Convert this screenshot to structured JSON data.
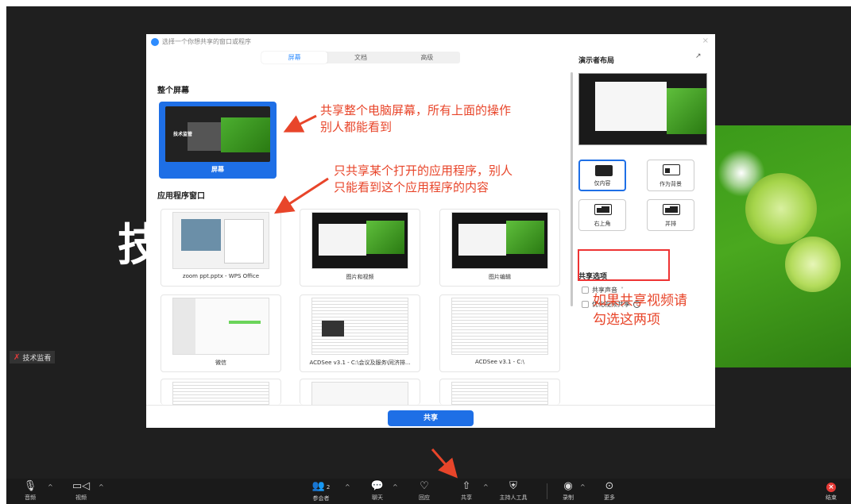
{
  "background": {
    "big_text": "技",
    "tech_tag": "技术监看"
  },
  "dialog": {
    "title": "选择一个你想共享的窗口或程序",
    "close": "×",
    "tabs": [
      {
        "label": "屏幕"
      },
      {
        "label": "文档"
      },
      {
        "label": "高级"
      }
    ],
    "section_screen": "整个屏幕",
    "screen_label": "屏幕",
    "screen_thumb_text": "技术监管",
    "section_apps": "应用程序窗口",
    "apps": [
      {
        "label": "zoom ppt.pptx - WPS Office"
      },
      {
        "label": "图片和视频"
      },
      {
        "label": "图片编辑"
      },
      {
        "label": "微信"
      },
      {
        "label": "ACDSee v3.1 - C:\\会议及服务\\同济排..."
      },
      {
        "label": "ACDSee v3.1 - C:\\"
      }
    ],
    "right": {
      "title": "演示者布局",
      "expand": "↗",
      "layouts": [
        {
          "label": "仅内容"
        },
        {
          "label": "作为背景"
        },
        {
          "label": "右上角"
        },
        {
          "label": "并排"
        }
      ],
      "share_options_title": "共享选项",
      "opt_audio": "共享声音",
      "opt_audio_caret": "˅",
      "opt_video": "优化视频共享",
      "opt_help": "?"
    },
    "share_button": "共享"
  },
  "annotations": {
    "a1_line1": "共享整个电脑屏幕，所有上面的操作",
    "a1_line2": "别人都能看到",
    "a2_line1": "只共享某个打开的应用程序，别人",
    "a2_line2": "只能看到这个应用程序的内容",
    "a3_line1": "如果共享视频请",
    "a3_line2": "勾选这两项",
    "color": "#e8452a"
  },
  "toolbar": {
    "audio": "音频",
    "video": "视频",
    "participants": "参会者",
    "participants_count": "2",
    "chat": "聊天",
    "reactions": "回应",
    "share": "共享",
    "host_tools": "主持人工具",
    "record": "录制",
    "more": "更多",
    "end": "结束",
    "caret": "^"
  }
}
